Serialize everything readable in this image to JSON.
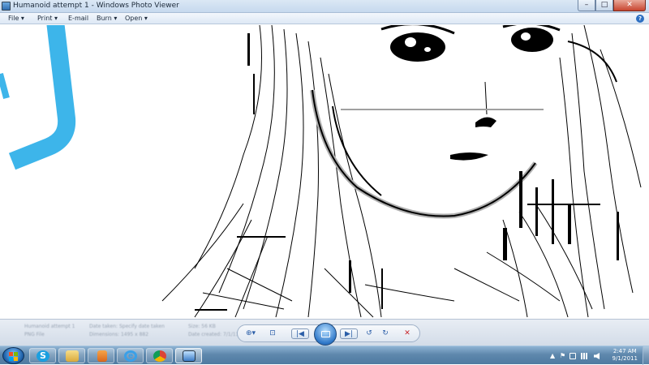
{
  "window": {
    "title": "Humanoid attempt 1 - Windows Photo Viewer",
    "minimize": "–",
    "maximize": "□",
    "close": "✕"
  },
  "menu": {
    "items": [
      "File ▾",
      "Print ▾",
      "E-mail",
      "Burn ▾",
      "Open ▾"
    ],
    "help": "?"
  },
  "image": {
    "icon": "sketch-image",
    "accent_color": "#3db5ea"
  },
  "controls": {
    "zoom": "⊕▾",
    "actual_size": "⊡",
    "previous": "|◀",
    "next": "▶|",
    "rotate_ccw": "↺",
    "rotate_cw": "↻",
    "delete": "✕"
  },
  "info_blurred": {
    "name": "Humanoid attempt 1",
    "file_type": "PNG File",
    "date_taken": "Date taken: Specify date taken",
    "dimensions": "Dimensions: 1495 x 882",
    "size": "Size: 56 KB",
    "date_created": "Date created: 7/1/11"
  },
  "taskbar": {
    "pinned": [
      "start-orb",
      "skype",
      "windows-explorer",
      "media-player",
      "internet-explorer",
      "google-chrome",
      "windows-photo-viewer"
    ]
  },
  "tray": {
    "show_hidden": "▲",
    "flag": "⚑",
    "time": "2:47 AM",
    "date": "9/1/2011"
  }
}
